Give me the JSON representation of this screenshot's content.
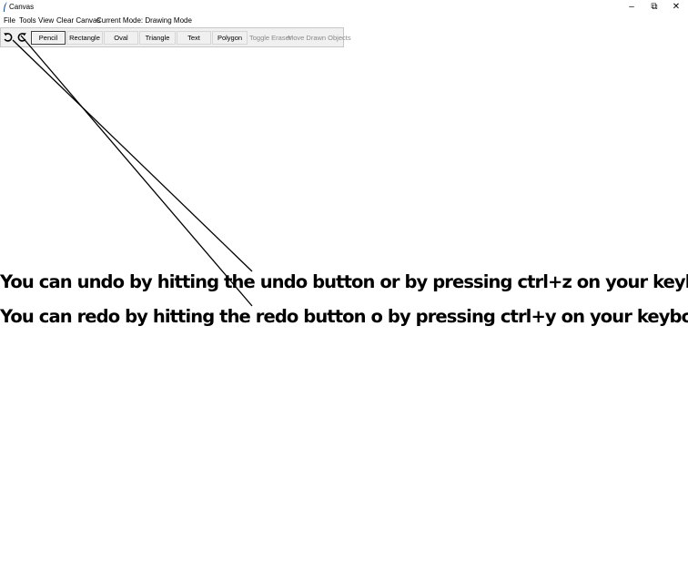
{
  "window": {
    "title": "Canvas",
    "minimize_label": "–",
    "restore_label": "⧉",
    "close_label": "✕"
  },
  "menu": {
    "items": [
      "File",
      "Tools",
      "View",
      "Clear Canvas",
      "Current Mode: Drawing Mode"
    ]
  },
  "toolbar": {
    "undo_icon": "undo-icon",
    "redo_icon": "redo-icon",
    "buttons": [
      "Pencil",
      "Rectangle",
      "Oval",
      "Triangle",
      "Text",
      "Polygon",
      "Toggle Eraser",
      "Move Drawn Objects"
    ],
    "active_button": "Pencil",
    "disabled_buttons": [
      "Toggle Eraser",
      "Move Drawn Objects"
    ]
  },
  "canvas": {
    "background": "#ffffff",
    "stroke_color": "#000000",
    "text_lines": [
      "You can undo by hitting the undo button or by pressing ctrl+z on your keyboard",
      "You can redo by hitting the redo button o by pressing ctrl+y on your keyboard"
    ]
  }
}
